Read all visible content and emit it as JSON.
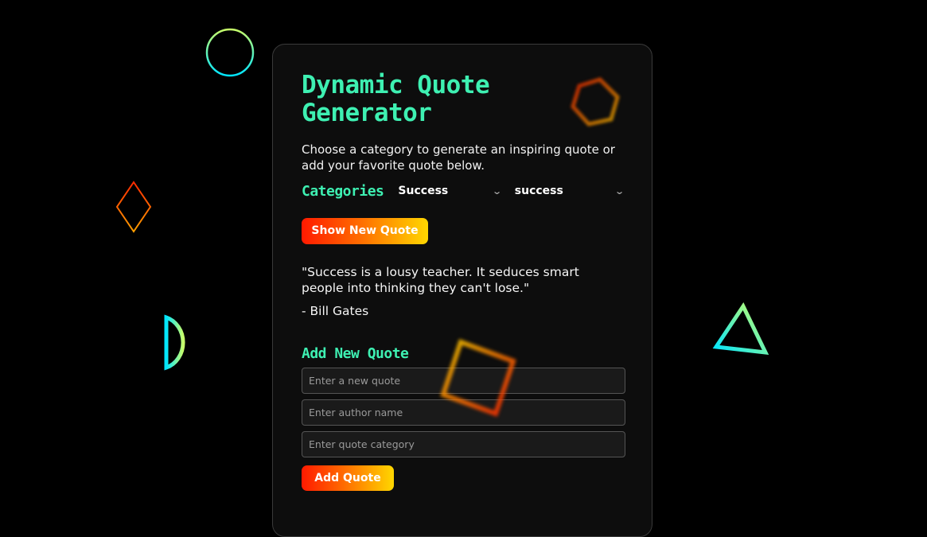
{
  "app": {
    "title": "Dynamic Quote Generator",
    "intro": "Choose a category to generate an inspiring quote or add your favorite quote below."
  },
  "categories": {
    "label": "Categories",
    "select_1": "Success",
    "select_2": "success"
  },
  "show_button": "Show New Quote",
  "quote": {
    "text": "\"Success is a lousy teacher. It seduces smart people into thinking they can't lose.\"",
    "author": "- Bill Gates"
  },
  "add_form": {
    "title": "Add New Quote",
    "quote_placeholder": "Enter a new quote",
    "author_placeholder": "Enter author name",
    "category_placeholder": "Enter quote category",
    "button": "Add Quote"
  },
  "colors": {
    "accent": "#3ef0b2",
    "button_gradient": [
      "#ff1a00",
      "#ffd700"
    ],
    "background": "#000000"
  },
  "icons": [
    "circle-shape-icon",
    "diamond-shape-icon",
    "half-circle-shape-icon",
    "triangle-shape-icon",
    "hexagon-shape-icon",
    "square-shape-icon",
    "chevron-down-icon"
  ]
}
